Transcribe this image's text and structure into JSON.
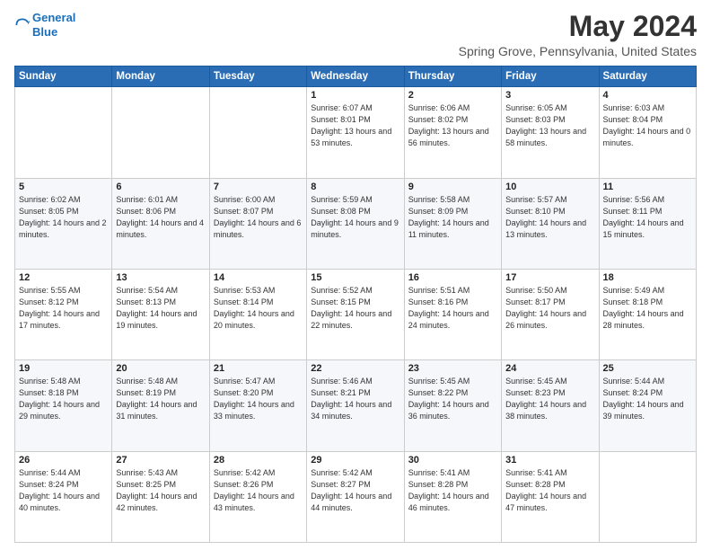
{
  "logo": {
    "line1": "General",
    "line2": "Blue"
  },
  "title": "May 2024",
  "subtitle": "Spring Grove, Pennsylvania, United States",
  "days_of_week": [
    "Sunday",
    "Monday",
    "Tuesday",
    "Wednesday",
    "Thursday",
    "Friday",
    "Saturday"
  ],
  "weeks": [
    [
      {
        "day": "",
        "sunrise": "",
        "sunset": "",
        "daylight": ""
      },
      {
        "day": "",
        "sunrise": "",
        "sunset": "",
        "daylight": ""
      },
      {
        "day": "",
        "sunrise": "",
        "sunset": "",
        "daylight": ""
      },
      {
        "day": "1",
        "sunrise": "Sunrise: 6:07 AM",
        "sunset": "Sunset: 8:01 PM",
        "daylight": "Daylight: 13 hours and 53 minutes."
      },
      {
        "day": "2",
        "sunrise": "Sunrise: 6:06 AM",
        "sunset": "Sunset: 8:02 PM",
        "daylight": "Daylight: 13 hours and 56 minutes."
      },
      {
        "day": "3",
        "sunrise": "Sunrise: 6:05 AM",
        "sunset": "Sunset: 8:03 PM",
        "daylight": "Daylight: 13 hours and 58 minutes."
      },
      {
        "day": "4",
        "sunrise": "Sunrise: 6:03 AM",
        "sunset": "Sunset: 8:04 PM",
        "daylight": "Daylight: 14 hours and 0 minutes."
      }
    ],
    [
      {
        "day": "5",
        "sunrise": "Sunrise: 6:02 AM",
        "sunset": "Sunset: 8:05 PM",
        "daylight": "Daylight: 14 hours and 2 minutes."
      },
      {
        "day": "6",
        "sunrise": "Sunrise: 6:01 AM",
        "sunset": "Sunset: 8:06 PM",
        "daylight": "Daylight: 14 hours and 4 minutes."
      },
      {
        "day": "7",
        "sunrise": "Sunrise: 6:00 AM",
        "sunset": "Sunset: 8:07 PM",
        "daylight": "Daylight: 14 hours and 6 minutes."
      },
      {
        "day": "8",
        "sunrise": "Sunrise: 5:59 AM",
        "sunset": "Sunset: 8:08 PM",
        "daylight": "Daylight: 14 hours and 9 minutes."
      },
      {
        "day": "9",
        "sunrise": "Sunrise: 5:58 AM",
        "sunset": "Sunset: 8:09 PM",
        "daylight": "Daylight: 14 hours and 11 minutes."
      },
      {
        "day": "10",
        "sunrise": "Sunrise: 5:57 AM",
        "sunset": "Sunset: 8:10 PM",
        "daylight": "Daylight: 14 hours and 13 minutes."
      },
      {
        "day": "11",
        "sunrise": "Sunrise: 5:56 AM",
        "sunset": "Sunset: 8:11 PM",
        "daylight": "Daylight: 14 hours and 15 minutes."
      }
    ],
    [
      {
        "day": "12",
        "sunrise": "Sunrise: 5:55 AM",
        "sunset": "Sunset: 8:12 PM",
        "daylight": "Daylight: 14 hours and 17 minutes."
      },
      {
        "day": "13",
        "sunrise": "Sunrise: 5:54 AM",
        "sunset": "Sunset: 8:13 PM",
        "daylight": "Daylight: 14 hours and 19 minutes."
      },
      {
        "day": "14",
        "sunrise": "Sunrise: 5:53 AM",
        "sunset": "Sunset: 8:14 PM",
        "daylight": "Daylight: 14 hours and 20 minutes."
      },
      {
        "day": "15",
        "sunrise": "Sunrise: 5:52 AM",
        "sunset": "Sunset: 8:15 PM",
        "daylight": "Daylight: 14 hours and 22 minutes."
      },
      {
        "day": "16",
        "sunrise": "Sunrise: 5:51 AM",
        "sunset": "Sunset: 8:16 PM",
        "daylight": "Daylight: 14 hours and 24 minutes."
      },
      {
        "day": "17",
        "sunrise": "Sunrise: 5:50 AM",
        "sunset": "Sunset: 8:17 PM",
        "daylight": "Daylight: 14 hours and 26 minutes."
      },
      {
        "day": "18",
        "sunrise": "Sunrise: 5:49 AM",
        "sunset": "Sunset: 8:18 PM",
        "daylight": "Daylight: 14 hours and 28 minutes."
      }
    ],
    [
      {
        "day": "19",
        "sunrise": "Sunrise: 5:48 AM",
        "sunset": "Sunset: 8:18 PM",
        "daylight": "Daylight: 14 hours and 29 minutes."
      },
      {
        "day": "20",
        "sunrise": "Sunrise: 5:48 AM",
        "sunset": "Sunset: 8:19 PM",
        "daylight": "Daylight: 14 hours and 31 minutes."
      },
      {
        "day": "21",
        "sunrise": "Sunrise: 5:47 AM",
        "sunset": "Sunset: 8:20 PM",
        "daylight": "Daylight: 14 hours and 33 minutes."
      },
      {
        "day": "22",
        "sunrise": "Sunrise: 5:46 AM",
        "sunset": "Sunset: 8:21 PM",
        "daylight": "Daylight: 14 hours and 34 minutes."
      },
      {
        "day": "23",
        "sunrise": "Sunrise: 5:45 AM",
        "sunset": "Sunset: 8:22 PM",
        "daylight": "Daylight: 14 hours and 36 minutes."
      },
      {
        "day": "24",
        "sunrise": "Sunrise: 5:45 AM",
        "sunset": "Sunset: 8:23 PM",
        "daylight": "Daylight: 14 hours and 38 minutes."
      },
      {
        "day": "25",
        "sunrise": "Sunrise: 5:44 AM",
        "sunset": "Sunset: 8:24 PM",
        "daylight": "Daylight: 14 hours and 39 minutes."
      }
    ],
    [
      {
        "day": "26",
        "sunrise": "Sunrise: 5:44 AM",
        "sunset": "Sunset: 8:24 PM",
        "daylight": "Daylight: 14 hours and 40 minutes."
      },
      {
        "day": "27",
        "sunrise": "Sunrise: 5:43 AM",
        "sunset": "Sunset: 8:25 PM",
        "daylight": "Daylight: 14 hours and 42 minutes."
      },
      {
        "day": "28",
        "sunrise": "Sunrise: 5:42 AM",
        "sunset": "Sunset: 8:26 PM",
        "daylight": "Daylight: 14 hours and 43 minutes."
      },
      {
        "day": "29",
        "sunrise": "Sunrise: 5:42 AM",
        "sunset": "Sunset: 8:27 PM",
        "daylight": "Daylight: 14 hours and 44 minutes."
      },
      {
        "day": "30",
        "sunrise": "Sunrise: 5:41 AM",
        "sunset": "Sunset: 8:28 PM",
        "daylight": "Daylight: 14 hours and 46 minutes."
      },
      {
        "day": "31",
        "sunrise": "Sunrise: 5:41 AM",
        "sunset": "Sunset: 8:28 PM",
        "daylight": "Daylight: 14 hours and 47 minutes."
      },
      {
        "day": "",
        "sunrise": "",
        "sunset": "",
        "daylight": ""
      }
    ]
  ]
}
